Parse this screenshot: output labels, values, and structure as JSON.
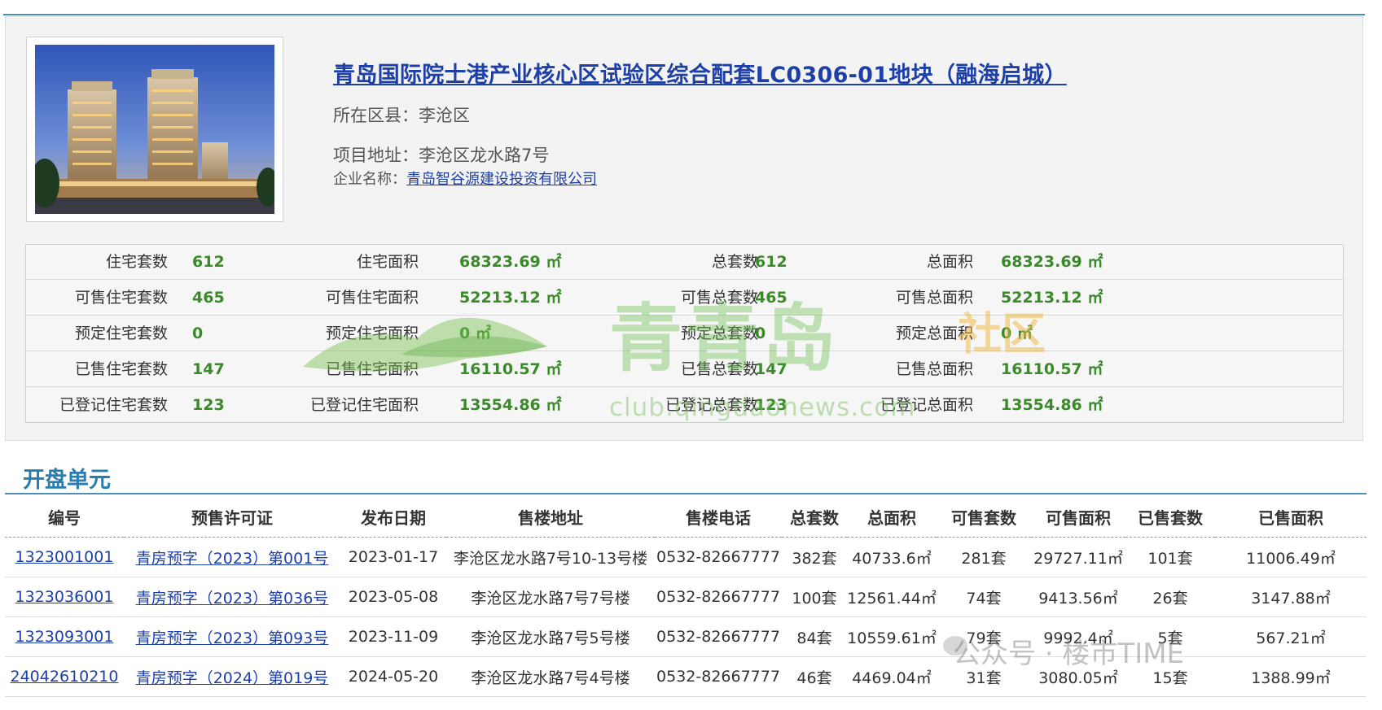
{
  "project": {
    "title": "青岛国际院士港产业核心区试验区综合配套LC0306-01地块（融海启城）",
    "district_label": "所在区县：",
    "district": "李沧区",
    "address_label": "项目地址：",
    "address": "李沧区龙水路7号",
    "company_label": "企业名称：",
    "company": "青岛智谷源建设投资有限公司"
  },
  "stats": {
    "rows": [
      [
        {
          "label": "住宅套数",
          "value": "612"
        },
        {
          "label": "住宅面积",
          "value": "68323.69 ㎡"
        },
        {
          "label": "总套数",
          "value": "612"
        },
        {
          "label": "总面积",
          "value": "68323.69 ㎡"
        }
      ],
      [
        {
          "label": "可售住宅套数",
          "value": "465"
        },
        {
          "label": "可售住宅面积",
          "value": "52213.12 ㎡"
        },
        {
          "label": "可售总套数",
          "value": "465"
        },
        {
          "label": "可售总面积",
          "value": "52213.12 ㎡"
        }
      ],
      [
        {
          "label": "预定住宅套数",
          "value": "0"
        },
        {
          "label": "预定住宅面积",
          "value": "0 ㎡"
        },
        {
          "label": "预定总套数",
          "value": "0"
        },
        {
          "label": "预定总面积",
          "value": "0 ㎡"
        }
      ],
      [
        {
          "label": "已售住宅套数",
          "value": "147"
        },
        {
          "label": "已售住宅面积",
          "value": "16110.57 ㎡"
        },
        {
          "label": "已售总套数",
          "value": "147"
        },
        {
          "label": "已售总面积",
          "value": "16110.57 ㎡"
        }
      ],
      [
        {
          "label": "已登记住宅套数",
          "value": "123"
        },
        {
          "label": "已登记住宅面积",
          "value": "13554.86 ㎡"
        },
        {
          "label": "已登记总套数",
          "value": "123"
        },
        {
          "label": "已登记总面积",
          "value": "13554.86 ㎡"
        }
      ]
    ]
  },
  "watermark": {
    "brand": "青青岛",
    "suffix": "社区",
    "url": "club.qingdaonews.com",
    "footer": "公众号 · 楼市TIME"
  },
  "units": {
    "section_title": "开盘单元",
    "columns": [
      "编号",
      "预售许可证",
      "发布日期",
      "售楼地址",
      "售楼电话",
      "总套数",
      "总面积",
      "可售套数",
      "可售面积",
      "已售套数",
      "已售面积"
    ],
    "rows": [
      [
        "1323001001",
        "青房预字（2023）第001号",
        "2023-01-17",
        "李沧区龙水路7号10-13号楼",
        "0532-82667777",
        "382套",
        "40733.6㎡",
        "281套",
        "29727.11㎡",
        "101套",
        "11006.49㎡"
      ],
      [
        "1323036001",
        "青房预字（2023）第036号",
        "2023-05-08",
        "李沧区龙水路7号7号楼",
        "0532-82667777",
        "100套",
        "12561.44㎡",
        "74套",
        "9413.56㎡",
        "26套",
        "3147.88㎡"
      ],
      [
        "1323093001",
        "青房预字（2023）第093号",
        "2023-11-09",
        "李沧区龙水路7号5号楼",
        "0532-82667777",
        "84套",
        "10559.61㎡",
        "79套",
        "9992.4㎡",
        "5套",
        "567.21㎡"
      ],
      [
        "24042610210",
        "青房预字（2024）第019号",
        "2024-05-20",
        "李沧区龙水路7号4号楼",
        "0532-82667777",
        "46套",
        "4469.04㎡",
        "31套",
        "3080.05㎡",
        "15套",
        "1388.99㎡"
      ]
    ]
  },
  "colors": {
    "link": "#1d3fa8",
    "accent": "#2a7db0",
    "value_green": "#3b8a2a"
  }
}
